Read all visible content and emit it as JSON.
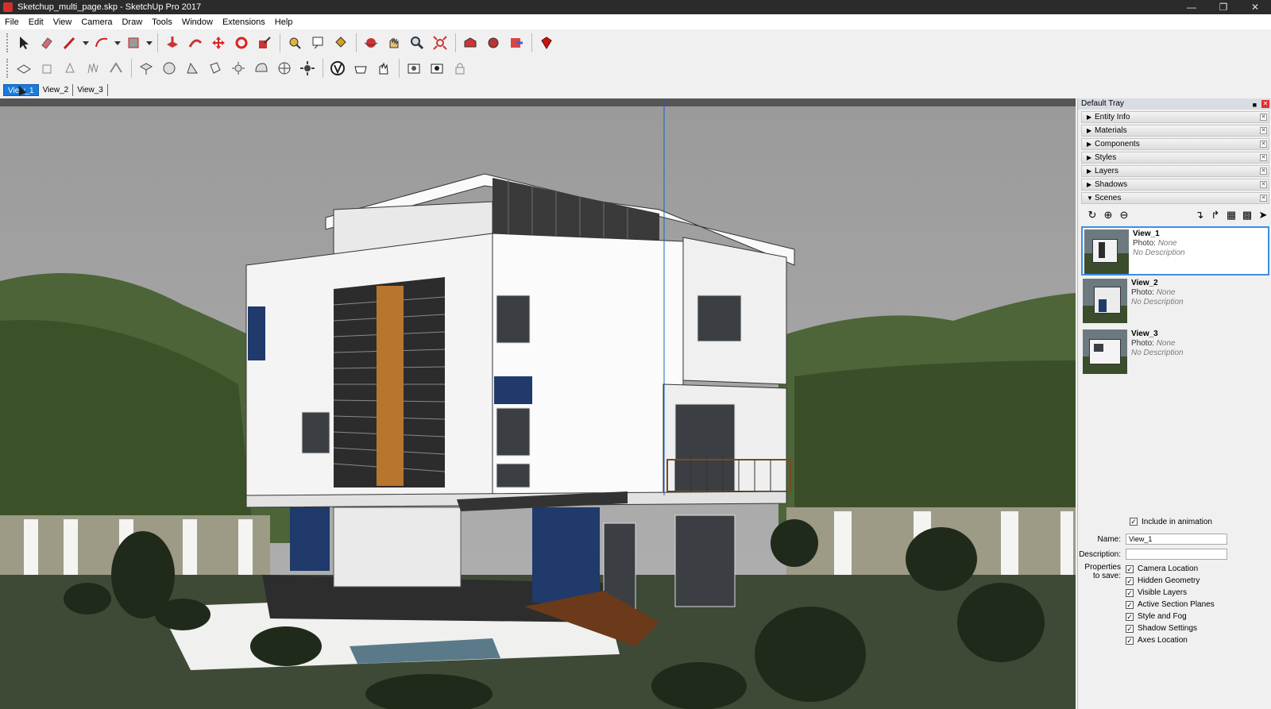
{
  "window": {
    "title": "Sketchup_multi_page.skp - SketchUp Pro 2017"
  },
  "menu": [
    "File",
    "Edit",
    "View",
    "Camera",
    "Draw",
    "Tools",
    "Window",
    "Extensions",
    "Help"
  ],
  "scene_tabs": [
    {
      "label": "View_1",
      "active": true
    },
    {
      "label": "View_2",
      "active": false
    },
    {
      "label": "View_3",
      "active": false
    }
  ],
  "tray": {
    "title": "Default Tray",
    "panels": [
      "Entity Info",
      "Materials",
      "Components",
      "Styles",
      "Layers",
      "Shadows",
      "Scenes"
    ],
    "scenes": [
      {
        "name": "View_1",
        "photo_label": "Photo:",
        "photo": "None",
        "description": "No Description",
        "selected": true
      },
      {
        "name": "View_2",
        "photo_label": "Photo:",
        "photo": "None",
        "description": "No Description",
        "selected": false
      },
      {
        "name": "View_3",
        "photo_label": "Photo:",
        "photo": "None",
        "description": "No Description",
        "selected": false
      }
    ],
    "include_in_animation": "Include in animation",
    "name_label": "Name:",
    "name_value": "View_1",
    "description_label": "Description:",
    "description_value": "",
    "properties_label": "Properties to save:",
    "properties": [
      "Camera Location",
      "Hidden Geometry",
      "Visible Layers",
      "Active Section Planes",
      "Style and Fog",
      "Shadow Settings",
      "Axes Location"
    ]
  },
  "colors": {
    "accent": "#1a7bd9",
    "sky": "#a6a6a6",
    "forest": "#3f5a2c",
    "wall": "#f2f2f2",
    "wood": "#b8752e",
    "navy": "#1f3a6b"
  }
}
